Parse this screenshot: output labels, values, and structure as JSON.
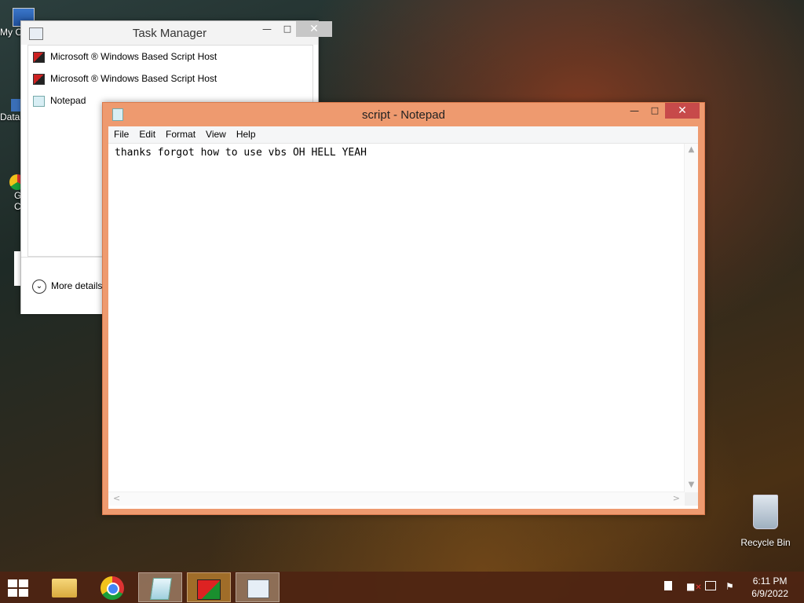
{
  "desktop": {
    "icons": [
      {
        "label": "My C"
      },
      {
        "label": "Data"
      },
      {
        "label": "G"
      },
      {
        "label": "C"
      },
      {
        "label": "Recycle Bin"
      }
    ]
  },
  "task_manager": {
    "title": "Task Manager",
    "processes": [
      {
        "name": "Microsoft ® Windows Based Script Host",
        "icon": "script-host-icon"
      },
      {
        "name": "Microsoft ® Windows Based Script Host",
        "icon": "script-host-icon"
      },
      {
        "name": "Notepad",
        "icon": "notepad-icon"
      }
    ],
    "more_details": "More details"
  },
  "notepad": {
    "title": "script - Notepad",
    "menu": [
      "File",
      "Edit",
      "Format",
      "View",
      "Help"
    ],
    "content": "thanks forgot how to use vbs OH HELL YEAH"
  },
  "window_controls": {
    "minimize": "—",
    "maximize": "□",
    "close": "✕"
  },
  "taskbar": {
    "items": [
      "start",
      "file-explorer",
      "chrome",
      "notepad",
      "script-host",
      "task-manager"
    ],
    "clock_time": "6:11 PM",
    "clock_date": "6/9/2022"
  },
  "colors": {
    "notepad_frame": "#ee9a6f",
    "close_red": "#c74a4a",
    "taskbar": "#4e2412"
  }
}
